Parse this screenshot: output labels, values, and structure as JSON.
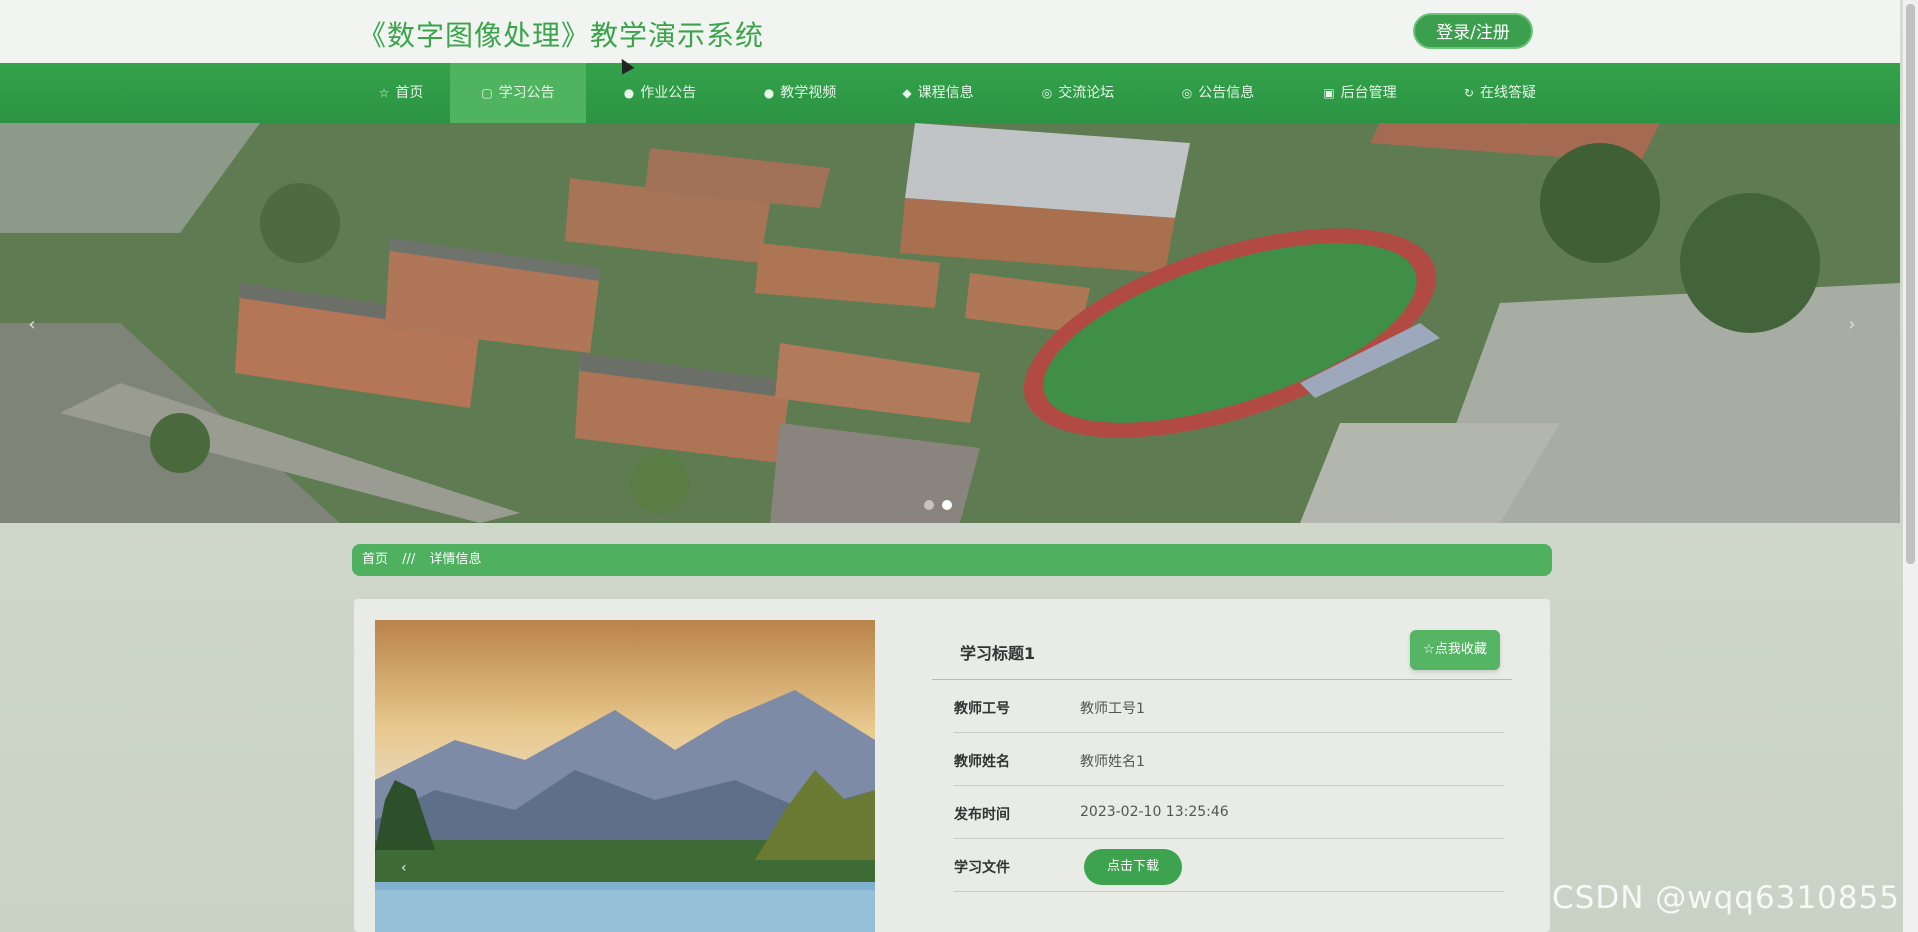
{
  "header": {
    "title": "《数字图像处理》教学演示系统",
    "login_label": "登录/注册"
  },
  "nav": {
    "items": [
      {
        "label": "首页",
        "icon": "star-icon",
        "glyph": "☆"
      },
      {
        "label": "学习公告",
        "icon": "clipboard-icon",
        "glyph": "▢"
      },
      {
        "label": "作业公告",
        "icon": "info-icon",
        "glyph": "●"
      },
      {
        "label": "教学视频",
        "icon": "play-icon",
        "glyph": "●"
      },
      {
        "label": "课程信息",
        "icon": "shield-icon",
        "glyph": "◆"
      },
      {
        "label": "交流论坛",
        "icon": "chat-icon",
        "glyph": "◎"
      },
      {
        "label": "公告信息",
        "icon": "bell-icon",
        "glyph": "◎"
      },
      {
        "label": "后台管理",
        "icon": "building-icon",
        "glyph": "▣"
      },
      {
        "label": "在线答疑",
        "icon": "headset-icon",
        "glyph": "↻"
      }
    ],
    "active_index": 1
  },
  "banner": {
    "prev_glyph": "‹",
    "next_glyph": "›",
    "slides": 2,
    "active_slide": 1
  },
  "breadcrumb": {
    "home": "首页",
    "separator": "///",
    "current": "详情信息"
  },
  "detail": {
    "title": "学习标题1",
    "favorite_label": "☆点我收藏",
    "fields": [
      {
        "label": "教师工号",
        "value": "教师工号1"
      },
      {
        "label": "教师姓名",
        "value": "教师姓名1"
      },
      {
        "label": "发布时间",
        "value": "2023-02-10 13:25:46"
      }
    ],
    "file_label": "学习文件",
    "download_label": "点击下载"
  },
  "photo": {
    "prev_glyph": "‹"
  },
  "watermark": "CSDN @wqq6310855",
  "colors": {
    "primary_green": "#2e9a46",
    "accent_green": "#4fb15f"
  }
}
